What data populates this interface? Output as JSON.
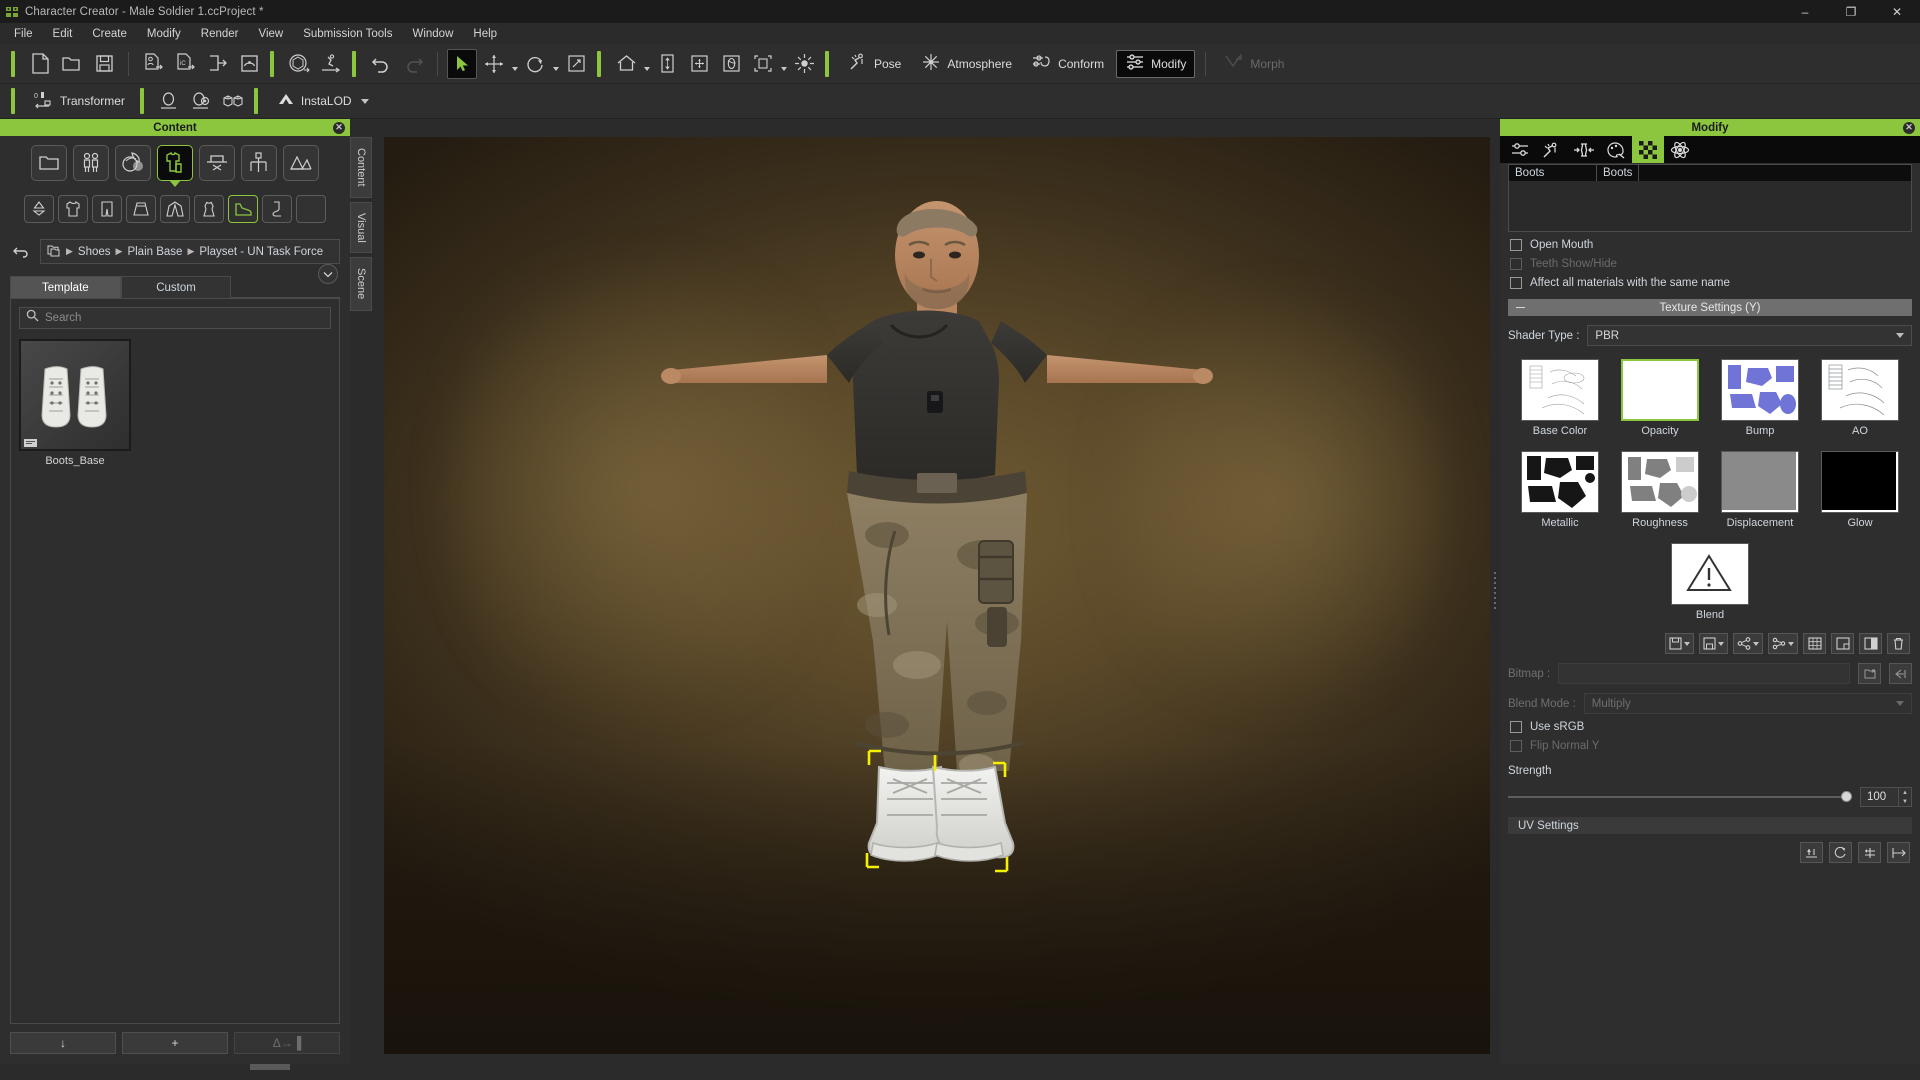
{
  "window": {
    "title": "Character Creator - Male Soldier 1.ccProject *",
    "app_icon": "character-creator-icon",
    "minimize": "–",
    "maximize": "❐",
    "close": "✕"
  },
  "menubar": {
    "items": [
      "File",
      "Edit",
      "Create",
      "Modify",
      "Render",
      "View",
      "Submission Tools",
      "Window",
      "Help"
    ]
  },
  "toolbar1": {
    "groups": [
      {
        "icons": [
          "new-project-icon",
          "open-project-icon",
          "save-project-icon"
        ]
      },
      {
        "icons": [
          "import-character-icon",
          "import-scene-icon",
          "export-icon",
          "export-package-icon"
        ]
      },
      {
        "icons": [
          "transfer-skin-weights-icon",
          "animation-player-icon"
        ]
      },
      {
        "icons": [
          "undo-icon",
          "redo-icon"
        ]
      },
      {
        "icons": [
          "select-tool-icon",
          "move-tool-icon",
          "rotate-tool-icon",
          "scale-tool-icon"
        ]
      },
      {
        "icons": [
          "home-view-icon",
          "fit-view-icon",
          "pan-view-icon",
          "orbit-view-icon",
          "frame-selected-icon",
          "light-icon"
        ]
      }
    ],
    "buttons": [
      {
        "label": "Pose",
        "icon": "pose-icon",
        "state": "normal"
      },
      {
        "label": "Atmosphere",
        "icon": "atmosphere-icon",
        "state": "normal"
      },
      {
        "label": "Conform",
        "icon": "conform-icon",
        "state": "normal"
      },
      {
        "label": "Modify",
        "icon": "modify-icon",
        "state": "active"
      },
      {
        "label": "Morph",
        "icon": "morph-icon",
        "state": "disabled"
      }
    ]
  },
  "toolbar2": {
    "transformer_label": "Transformer",
    "transformer_icon": "transformer-icon",
    "icons": [
      "headshot-icon",
      "skingen-icon",
      "mesh-tools-icon"
    ],
    "instalod_label": "InstaLOD",
    "instalod_icon": "instalod-icon"
  },
  "content_panel": {
    "title": "Content",
    "close_icon": "close-icon",
    "categories": [
      {
        "icon": "folder-icon",
        "name": "custom-content",
        "selected": false
      },
      {
        "icon": "actor-icon",
        "name": "actor",
        "selected": false
      },
      {
        "icon": "skin-icon",
        "name": "skin",
        "selected": false
      },
      {
        "icon": "cloth-icon",
        "name": "cloth",
        "selected": true
      },
      {
        "icon": "accessory-icon",
        "name": "accessory",
        "selected": false
      },
      {
        "icon": "prop-icon",
        "name": "prop",
        "selected": false
      },
      {
        "icon": "scene-icon",
        "name": "scene",
        "selected": false
      }
    ],
    "subcategories": [
      {
        "icon": "underwear-icon",
        "name": "underwear",
        "selected": false
      },
      {
        "icon": "tshirt-icon",
        "name": "tops",
        "selected": false
      },
      {
        "icon": "pants-icon",
        "name": "bottoms",
        "selected": false
      },
      {
        "icon": "skirt-icon",
        "name": "skirts",
        "selected": false
      },
      {
        "icon": "outerwear-icon",
        "name": "outerwear",
        "selected": false
      },
      {
        "icon": "dress-icon",
        "name": "dress",
        "selected": false
      },
      {
        "icon": "shoes-icon",
        "name": "shoes",
        "selected": true
      },
      {
        "icon": "sock-icon",
        "name": "socks",
        "selected": false
      },
      {
        "icon": "blank-icon",
        "name": "others",
        "selected": false
      }
    ],
    "breadcrumb": {
      "back_icon": "back-arrow-icon",
      "root_icon": "content-root-icon",
      "path": [
        "Shoes",
        "Plain Base",
        "Playset - UN Task Force"
      ],
      "separator": "▶"
    },
    "tabs": [
      {
        "label": "Template",
        "active": true
      },
      {
        "label": "Custom",
        "active": false
      }
    ],
    "options_icon": "panel-options-icon",
    "search": {
      "placeholder": "Search",
      "value": "",
      "icon": "search-icon"
    },
    "items": [
      {
        "label": "Boots_Base",
        "thumb": "white-boots-thumbnail",
        "badge": "content-badge-icon"
      }
    ],
    "footer": [
      {
        "label": "↓",
        "name": "download-button",
        "disabled": false
      },
      {
        "label": "+",
        "name": "add-button",
        "disabled": false
      },
      {
        "label": "Δ→▐",
        "name": "apply-button",
        "disabled": true
      }
    ]
  },
  "vtabs": [
    {
      "label": "Content"
    },
    {
      "label": "Visual"
    },
    {
      "label": "Scene"
    }
  ],
  "modify_panel": {
    "title": "Modify",
    "close_icon": "close-icon",
    "tabs": [
      {
        "icon": "attribute-icon",
        "name": "attribute",
        "active": false
      },
      {
        "icon": "pose-offset-icon",
        "name": "pose-offset",
        "active": false
      },
      {
        "icon": "collision-shape-icon",
        "name": "collision-shape",
        "active": false
      },
      {
        "icon": "appearance-editor-icon",
        "name": "appearance-editor",
        "active": false
      },
      {
        "icon": "material-icon",
        "name": "material",
        "active": true
      },
      {
        "icon": "physics-icon",
        "name": "physics",
        "active": false
      }
    ],
    "material_table": {
      "columns": [
        "Boots",
        "Boots"
      ],
      "rows": []
    },
    "checkboxes": [
      {
        "label": "Open Mouth",
        "checked": false,
        "disabled": false
      },
      {
        "label": "Teeth Show/Hide",
        "checked": false,
        "disabled": true
      },
      {
        "label": "Affect all materials with the same name",
        "checked": false,
        "disabled": false
      }
    ],
    "texture_settings": {
      "section_title": "Texture Settings  (Y)",
      "shader_label": "Shader Type :",
      "shader_value": "PBR",
      "maps": [
        {
          "label": "Base Color",
          "thumb": "uv-lineart-white",
          "selected": false
        },
        {
          "label": "Opacity",
          "thumb": "blank-white",
          "selected": true
        },
        {
          "label": "Bump",
          "thumb": "uv-blue-islands",
          "selected": false
        },
        {
          "label": "AO",
          "thumb": "uv-lineart-white",
          "selected": false
        },
        {
          "label": "Metallic",
          "thumb": "uv-black-islands",
          "selected": false
        },
        {
          "label": "Roughness",
          "thumb": "uv-gray-islands",
          "selected": false
        },
        {
          "label": "Displacement",
          "thumb": "solid-gray",
          "selected": false
        },
        {
          "label": "Glow",
          "thumb": "solid-black",
          "selected": false
        },
        {
          "label": "Blend",
          "thumb": "warning-triangle",
          "selected": false
        }
      ],
      "tool_icons": [
        "load-texture-icon",
        "save-texture-icon",
        "share-texture-icon",
        "link-texture-icon",
        "tile-texture-icon",
        "open-folder-icon",
        "swap-texture-icon",
        "delete-texture-icon"
      ],
      "bitmap_label": "Bitmap :",
      "bitmap_value": "",
      "bitmap_icons": [
        "browse-bitmap-icon",
        "reset-bitmap-icon"
      ],
      "blend_mode_label": "Blend Mode :",
      "blend_mode_value": "Multiply",
      "use_srgb": {
        "label": "Use sRGB",
        "checked": false,
        "disabled": false
      },
      "flip_normal_y": {
        "label": "Flip Normal Y",
        "checked": false,
        "disabled": true
      },
      "strength_label": "Strength",
      "strength_value": "100",
      "strength_percent": 100
    },
    "uv_settings": {
      "section_title": "UV Settings",
      "tool_icons": [
        "uv-flip-h-icon",
        "uv-flip-v-icon",
        "uv-rotate-icon",
        "uv-offset-icon"
      ]
    }
  },
  "colors": {
    "accent_green": "#8cc63e",
    "panel_bg": "#2e2e2e",
    "window_bg": "#2b2b2b",
    "toolbar_bg": "#2e2e2e",
    "text": "#cfd6de"
  }
}
